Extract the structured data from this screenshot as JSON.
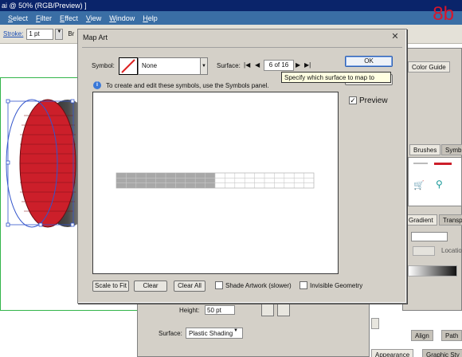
{
  "app": {
    "title": "ai @ 50% (RGB/Preview) ]",
    "menu": [
      "Select",
      "Filter",
      "Effect",
      "View",
      "Window",
      "Help"
    ],
    "step_label": "8b"
  },
  "control_bar": {
    "stroke_label": "Stroke:",
    "stroke_value": "1 pt",
    "extra": "Br"
  },
  "right_panels": {
    "tab_color_guide": "Color Guide",
    "tab_brushes": "Brushes",
    "tab_symbols": "Symb",
    "tab_gradient": "Gradient",
    "tab_transparency": "Transpa",
    "location_label": "Location",
    "tab_align": "Align",
    "tab_path": "Path",
    "tab_appearance": "Appearance",
    "tab_graphic_styles": "Graphic Sty"
  },
  "dialog": {
    "title": "Map Art",
    "close_glyph": "✕",
    "symbol_label": "Symbol:",
    "symbol_value": "None",
    "surface_label": "Surface:",
    "surface_value": "6 of 16",
    "nav_first": "|◀",
    "nav_prev": "◀",
    "nav_next": "▶",
    "nav_last": "▶|",
    "ok_label": "OK",
    "tooltip": "Specify which surface to map to",
    "info_text": "To create and edit these symbols, use the Symbols panel.",
    "preview_label": "Preview",
    "preview_checked": true,
    "scale_to_fit_label": "Scale to Fit",
    "clear_label": "Clear",
    "clear_all_label": "Clear All",
    "shade_artwork_label": "Shade Artwork (slower)",
    "shade_artwork_checked": false,
    "invisible_geometry_label": "Invisible Geometry",
    "invisible_geometry_checked": false
  },
  "lower_panel": {
    "height_label": "Height:",
    "height_value": "50 pt",
    "surface_label": "Surface:",
    "surface_value": "Plastic Shading"
  },
  "colors": {
    "app_title_bg": "#0a246a",
    "menu_bg": "#3a6ea5",
    "dialog_bg": "#d4d0c8",
    "step_label": "#d8162c",
    "tire_red": "#cc1f2a",
    "guide_green": "#33b54a",
    "selection_blue": "#3355cc",
    "mapped_surface_grey": "#a8a8a8"
  }
}
